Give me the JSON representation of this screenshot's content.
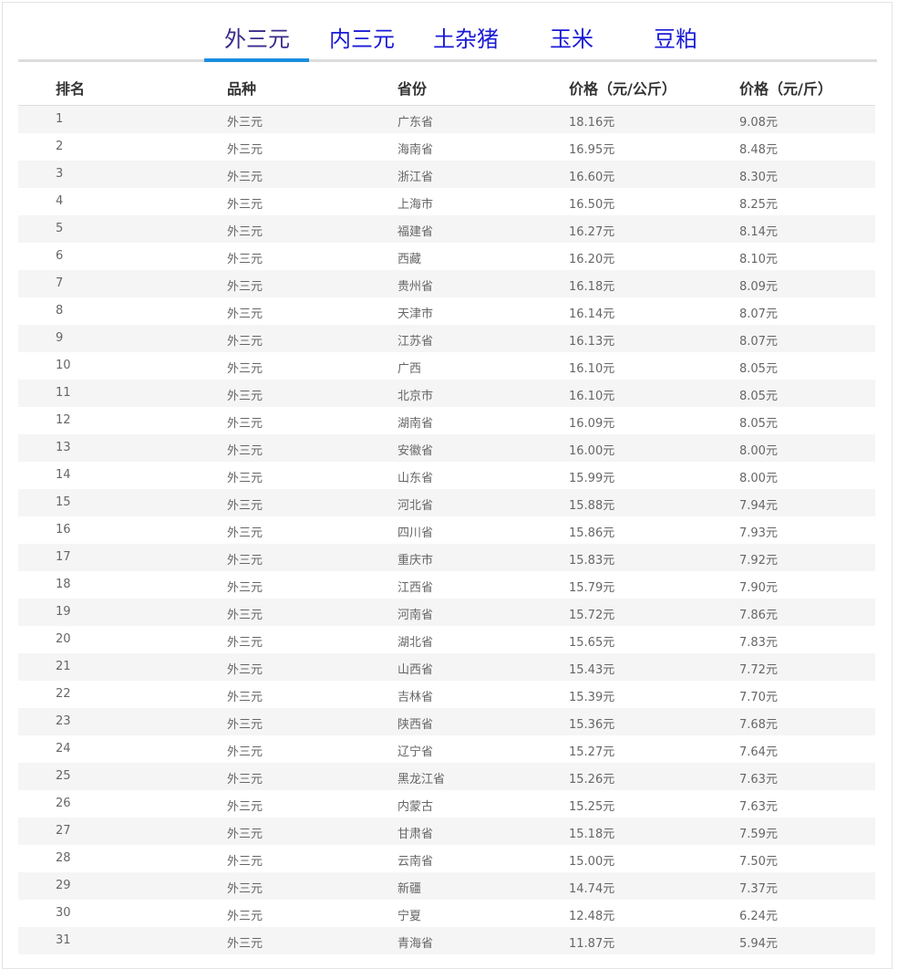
{
  "tabs": [
    {
      "label": "外三元",
      "active": true
    },
    {
      "label": "内三元",
      "active": false
    },
    {
      "label": "土杂猪",
      "active": false
    },
    {
      "label": "玉米",
      "active": false
    },
    {
      "label": "豆粕",
      "active": false
    }
  ],
  "table": {
    "headers": [
      "排名",
      "品种",
      "省份",
      "价格（元/公斤）",
      "价格（元/斤）"
    ],
    "rows": [
      [
        "1",
        "外三元",
        "广东省",
        "18.16元",
        "9.08元"
      ],
      [
        "2",
        "外三元",
        "海南省",
        "16.95元",
        "8.48元"
      ],
      [
        "3",
        "外三元",
        "浙江省",
        "16.60元",
        "8.30元"
      ],
      [
        "4",
        "外三元",
        "上海市",
        "16.50元",
        "8.25元"
      ],
      [
        "5",
        "外三元",
        "福建省",
        "16.27元",
        "8.14元"
      ],
      [
        "6",
        "外三元",
        "西藏",
        "16.20元",
        "8.10元"
      ],
      [
        "7",
        "外三元",
        "贵州省",
        "16.18元",
        "8.09元"
      ],
      [
        "8",
        "外三元",
        "天津市",
        "16.14元",
        "8.07元"
      ],
      [
        "9",
        "外三元",
        "江苏省",
        "16.13元",
        "8.07元"
      ],
      [
        "10",
        "外三元",
        "广西",
        "16.10元",
        "8.05元"
      ],
      [
        "11",
        "外三元",
        "北京市",
        "16.10元",
        "8.05元"
      ],
      [
        "12",
        "外三元",
        "湖南省",
        "16.09元",
        "8.05元"
      ],
      [
        "13",
        "外三元",
        "安徽省",
        "16.00元",
        "8.00元"
      ],
      [
        "14",
        "外三元",
        "山东省",
        "15.99元",
        "8.00元"
      ],
      [
        "15",
        "外三元",
        "河北省",
        "15.88元",
        "7.94元"
      ],
      [
        "16",
        "外三元",
        "四川省",
        "15.86元",
        "7.93元"
      ],
      [
        "17",
        "外三元",
        "重庆市",
        "15.83元",
        "7.92元"
      ],
      [
        "18",
        "外三元",
        "江西省",
        "15.79元",
        "7.90元"
      ],
      [
        "19",
        "外三元",
        "河南省",
        "15.72元",
        "7.86元"
      ],
      [
        "20",
        "外三元",
        "湖北省",
        "15.65元",
        "7.83元"
      ],
      [
        "21",
        "外三元",
        "山西省",
        "15.43元",
        "7.72元"
      ],
      [
        "22",
        "外三元",
        "吉林省",
        "15.39元",
        "7.70元"
      ],
      [
        "23",
        "外三元",
        "陕西省",
        "15.36元",
        "7.68元"
      ],
      [
        "24",
        "外三元",
        "辽宁省",
        "15.27元",
        "7.64元"
      ],
      [
        "25",
        "外三元",
        "黑龙江省",
        "15.26元",
        "7.63元"
      ],
      [
        "26",
        "外三元",
        "内蒙古",
        "15.25元",
        "7.63元"
      ],
      [
        "27",
        "外三元",
        "甘肃省",
        "15.18元",
        "7.59元"
      ],
      [
        "28",
        "外三元",
        "云南省",
        "15.00元",
        "7.50元"
      ],
      [
        "29",
        "外三元",
        "新疆",
        "14.74元",
        "7.37元"
      ],
      [
        "30",
        "外三元",
        "宁夏",
        "12.48元",
        "6.24元"
      ],
      [
        "31",
        "外三元",
        "青海省",
        "11.87元",
        "5.94元"
      ]
    ]
  },
  "colors": {
    "tab_text": "#1a1ad6",
    "tab_active_text": "#3a2a8a",
    "tab_underline": "#1a8ee0",
    "stripe": "#f5f5f5",
    "cell_text": "#666666",
    "header_text": "#333333"
  }
}
